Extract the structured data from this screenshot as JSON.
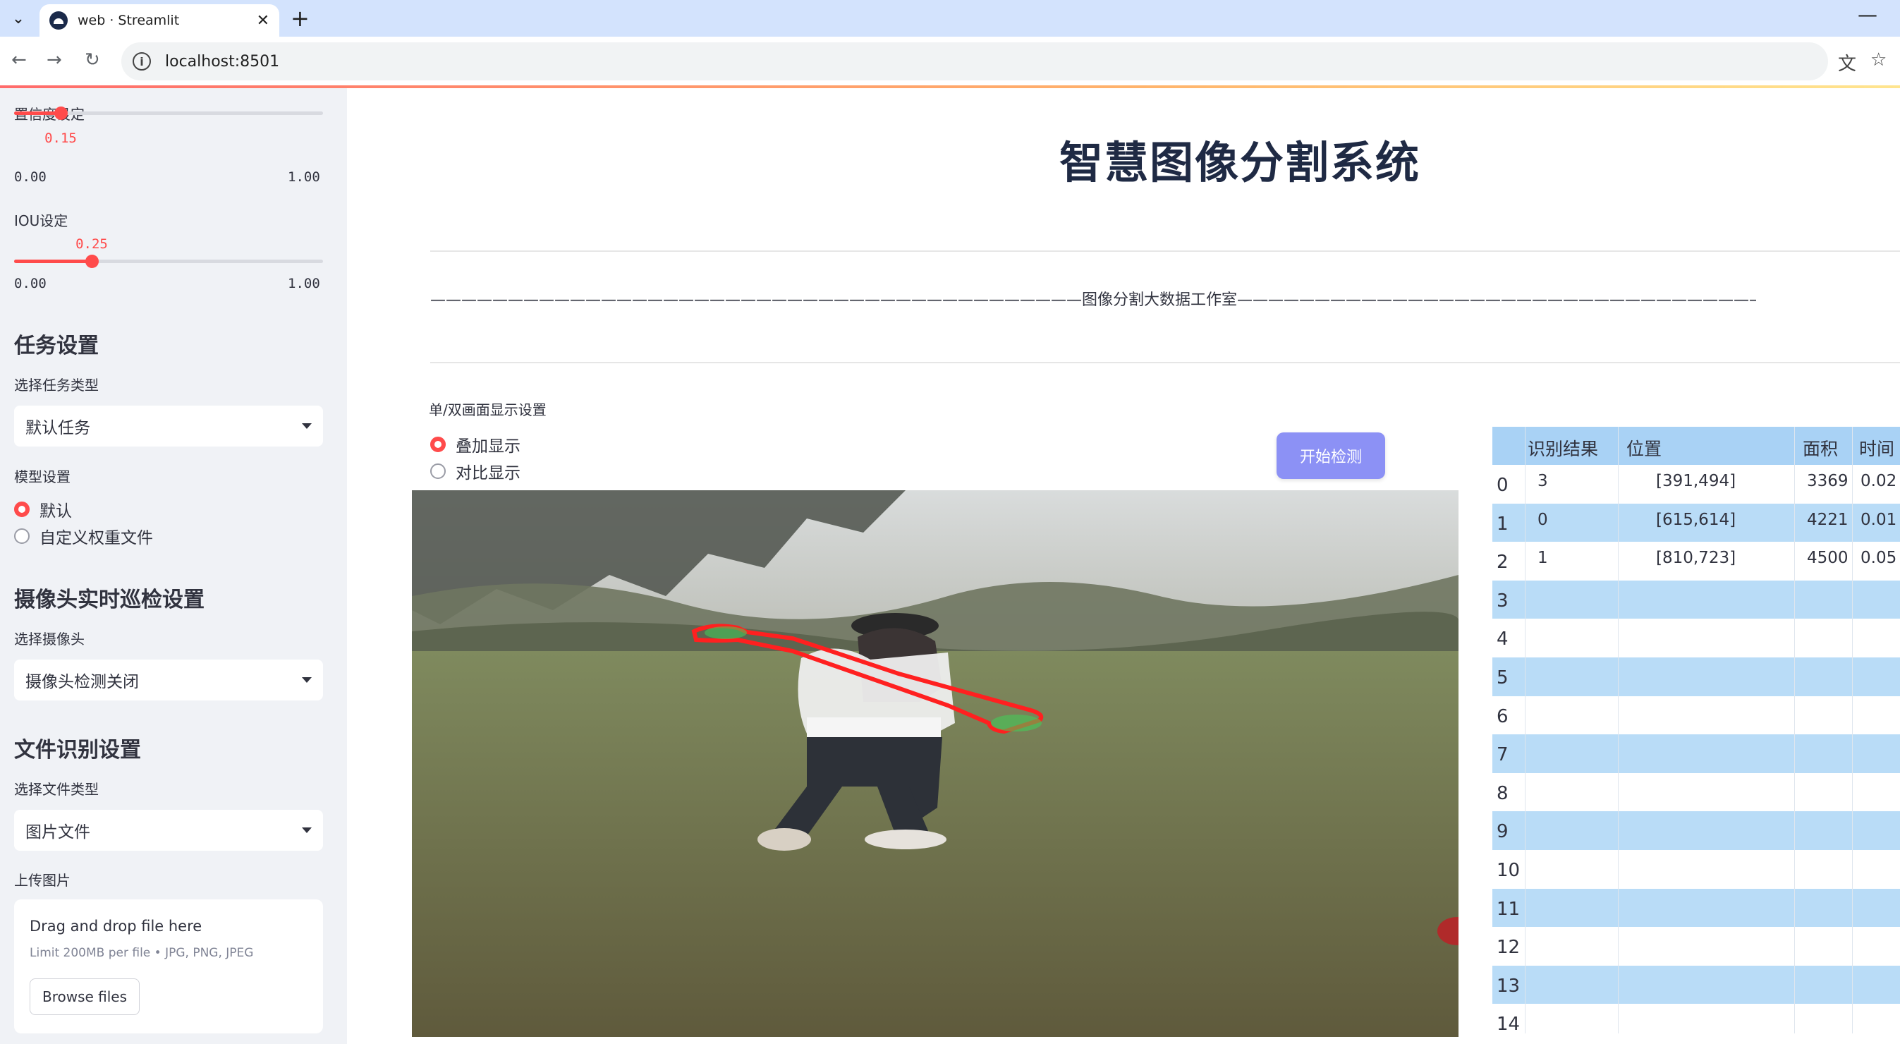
{
  "browser": {
    "tab_title": "web · Streamlit",
    "url": "localhost:8501"
  },
  "sidebar": {
    "confidence": {
      "label": "置信度设定",
      "value": "0.15",
      "min": "0.00",
      "max": "1.00",
      "fraction": 0.15
    },
    "iou": {
      "label": "IOU设定",
      "value": "0.25",
      "min": "0.00",
      "max": "1.00",
      "fraction": 0.25
    },
    "task_heading": "任务设置",
    "task_type_label": "选择任务类型",
    "task_type_value": "默认任务",
    "model_label": "模型设置",
    "model_options": [
      "默认",
      "自定义权重文件"
    ],
    "model_selected": 0,
    "camera_heading": "摄像头实时巡检设置",
    "camera_label": "选择摄像头",
    "camera_value": "摄像头检测关闭",
    "file_heading": "文件识别设置",
    "file_type_label": "选择文件类型",
    "file_type_value": "图片文件",
    "upload_label": "上传图片",
    "upload_title": "Drag and drop file here",
    "upload_limit": "Limit 200MB per file • JPG, PNG, JPEG",
    "upload_button": "Browse files"
  },
  "main": {
    "title": "智慧图像分割系统",
    "divider_text": "——————————————————————————————————————————图像分割大数据工作室——————————————————————————————————————————",
    "display_label": "单/双画面显示设置",
    "display_options": [
      "叠加显示",
      "对比显示"
    ],
    "display_selected": 0,
    "start_button": "开始检测"
  },
  "table": {
    "headers": [
      "识别结果",
      "位置",
      "面积",
      "时间"
    ],
    "rows": [
      {
        "index": "0",
        "result": "3",
        "position": "[391,494]",
        "area": "3369",
        "time": "0.02"
      },
      {
        "index": "1",
        "result": "0",
        "position": "[615,614]",
        "area": "4221",
        "time": "0.01"
      },
      {
        "index": "2",
        "result": "1",
        "position": "[810,723]",
        "area": "4500",
        "time": "0.05"
      },
      {
        "index": "3"
      },
      {
        "index": "4"
      },
      {
        "index": "5"
      },
      {
        "index": "6"
      },
      {
        "index": "7"
      },
      {
        "index": "8"
      },
      {
        "index": "9"
      },
      {
        "index": "10"
      },
      {
        "index": "11"
      },
      {
        "index": "12"
      },
      {
        "index": "13"
      },
      {
        "index": "14"
      }
    ]
  },
  "colors": {
    "accent": "#ff4b4b",
    "button": "#8c91f5",
    "table_header": "#a9d2f5",
    "table_alt": "#b9dcf7",
    "sidebar_bg": "#f0f2f6",
    "segmentation_outline": "#ff2020"
  }
}
